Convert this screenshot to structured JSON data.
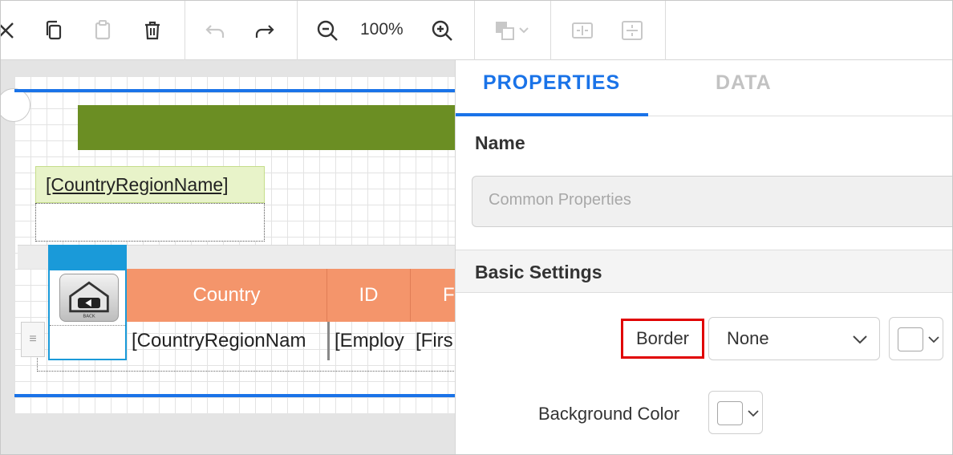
{
  "toolbar": {
    "zoom_level": "100%",
    "icons": [
      "cut-icon",
      "copy-icon",
      "paste-icon",
      "delete-icon",
      "undo-icon",
      "redo-icon",
      "zoom-out-icon",
      "zoom-in-icon",
      "order-icon",
      "align-horizontal-icon",
      "align-vertical-icon"
    ]
  },
  "canvas": {
    "field_label": "[CountryRegionName]",
    "table": {
      "headers": [
        "Country",
        "ID",
        "F"
      ],
      "cells": [
        "[CountryRegionNam",
        "[Employ",
        "[Firs"
      ],
      "image_caption": "BACK"
    }
  },
  "panel": {
    "tabs": [
      {
        "label": "PROPERTIES",
        "active": true
      },
      {
        "label": "DATA",
        "active": false
      }
    ],
    "name_label": "Name",
    "name_value": "Common Properties",
    "section_title": "Basic Settings",
    "border_label": "Border",
    "border_value": "None",
    "background_label": "Background Color"
  },
  "colors": {
    "accent": "#1a73e8",
    "header_cell": "#f4956b",
    "green_bar": "#6b8e23",
    "highlight": "#e00000",
    "column_select": "#1a9ad9"
  }
}
